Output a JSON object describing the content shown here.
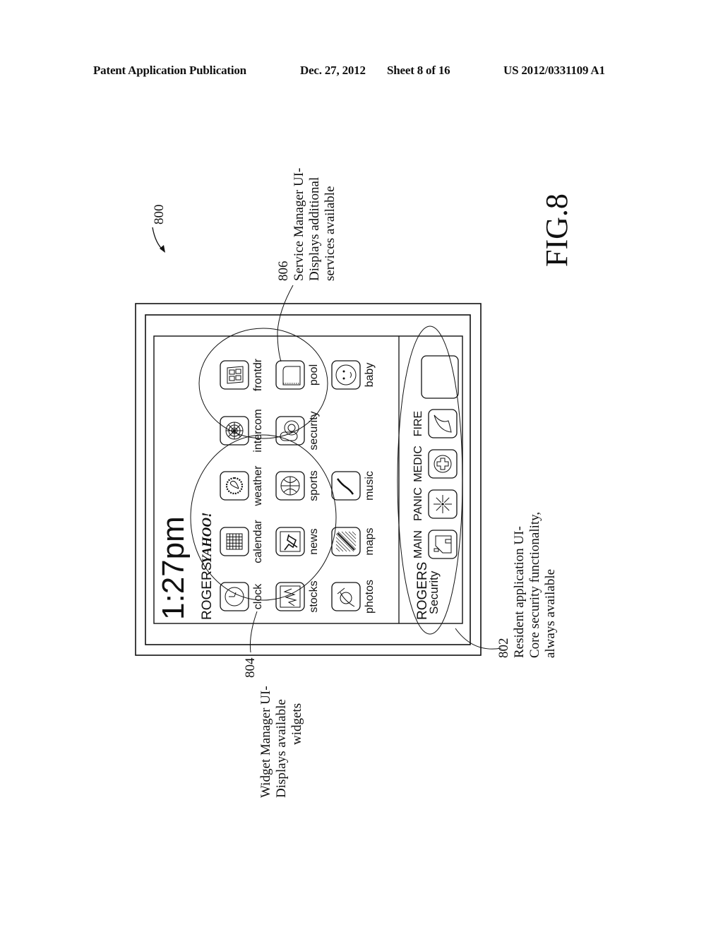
{
  "header": {
    "publication": "Patent Application Publication",
    "date": "Dec. 27, 2012",
    "sheet": "Sheet 8 of 16",
    "patent_number": "US 2012/0331109 A1"
  },
  "figure": {
    "label": "FIG.8",
    "reference": "800"
  },
  "screen": {
    "time": "1:27pm",
    "brand": "ROGERS",
    "partner_logo": "YAHOO!",
    "widgets": [
      {
        "label": "clock",
        "icon": "clock-icon"
      },
      {
        "label": "calendar",
        "icon": "calendar-icon"
      },
      {
        "label": "weather",
        "icon": "weather-icon"
      },
      {
        "label": "stocks",
        "icon": "stocks-icon"
      },
      {
        "label": "news",
        "icon": "news-icon"
      },
      {
        "label": "sports",
        "icon": "basketball-icon"
      },
      {
        "label": "photos",
        "icon": "photo-icon"
      },
      {
        "label": "maps",
        "icon": "map-icon"
      },
      {
        "label": "music",
        "icon": "music-icon"
      }
    ],
    "services": [
      {
        "label": "intercom",
        "icon": "intercom-icon"
      },
      {
        "label": "frontdr",
        "icon": "front-door-icon"
      },
      {
        "label": "security",
        "icon": "padlock-icon"
      },
      {
        "label": "pool",
        "icon": "pool-icon"
      },
      {
        "label": "baby",
        "icon": "baby-icon"
      }
    ],
    "security_bar": {
      "brand": "ROGERS",
      "subtitle": "Security",
      "buttons": [
        {
          "label": "MAIN",
          "icon": "house-icon"
        },
        {
          "label": "PANIC",
          "icon": "burst-icon"
        },
        {
          "label": "MEDIC",
          "icon": "medical-cross-icon"
        },
        {
          "label": "FIRE",
          "icon": "flame-icon"
        },
        {
          "label": "",
          "icon": "blank-button"
        }
      ]
    }
  },
  "callouts": [
    {
      "ref": "802",
      "lines": [
        "Resident application UI-",
        "Core security functionality,",
        "always available"
      ]
    },
    {
      "ref": "804",
      "lines": [
        "Widget Manager UI-",
        "Displays available",
        "widgets"
      ]
    },
    {
      "ref": "806",
      "lines": [
        "Service Manager UI-",
        "Displays additional",
        "services available"
      ]
    }
  ]
}
